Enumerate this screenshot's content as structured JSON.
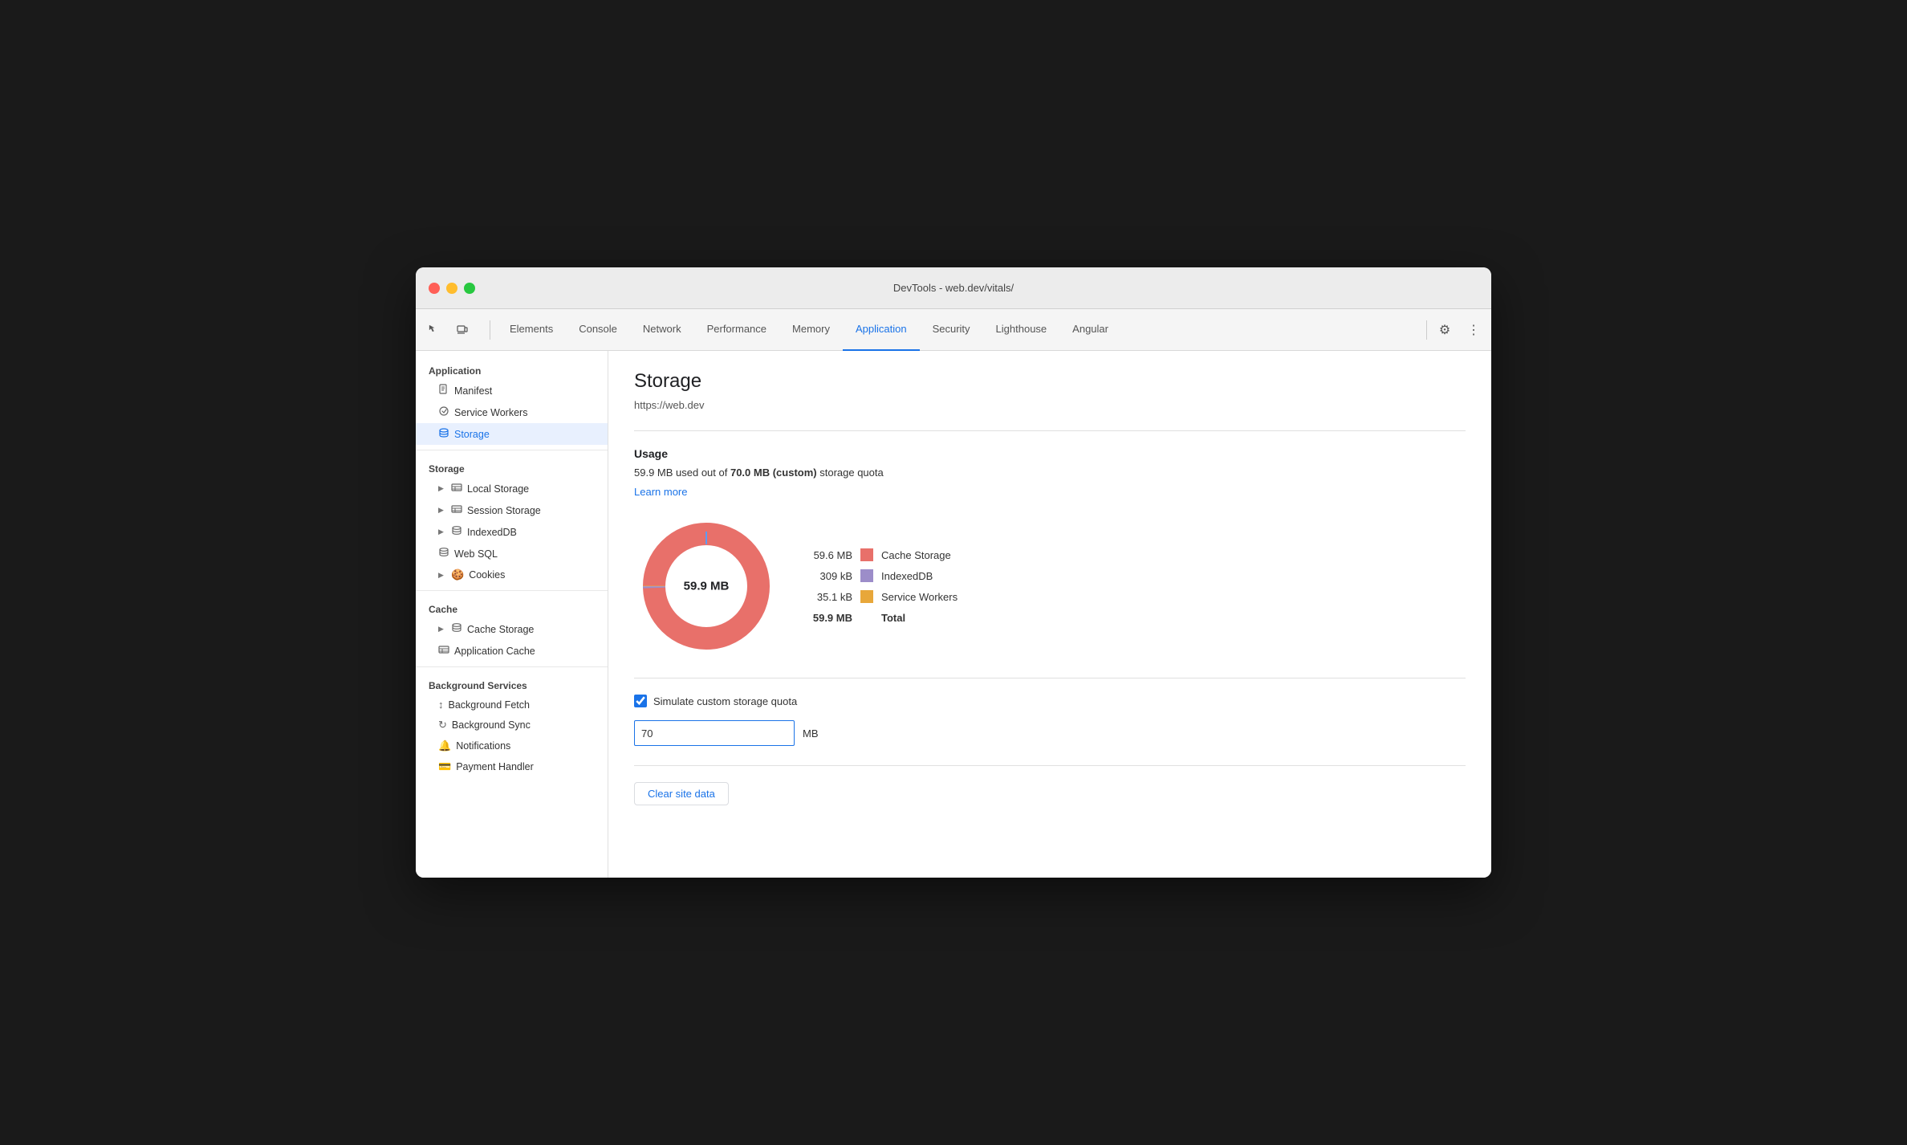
{
  "window": {
    "title": "DevTools - web.dev/vitals/"
  },
  "tabs": {
    "items": [
      {
        "label": "Elements",
        "active": false
      },
      {
        "label": "Console",
        "active": false
      },
      {
        "label": "Network",
        "active": false
      },
      {
        "label": "Performance",
        "active": false
      },
      {
        "label": "Memory",
        "active": false
      },
      {
        "label": "Application",
        "active": true
      },
      {
        "label": "Security",
        "active": false
      },
      {
        "label": "Lighthouse",
        "active": false
      },
      {
        "label": "Angular",
        "active": false
      }
    ]
  },
  "sidebar": {
    "application_label": "Application",
    "items_application": [
      {
        "label": "Manifest",
        "icon": "📄",
        "indent": 1
      },
      {
        "label": "Service Workers",
        "icon": "⚙️",
        "indent": 1
      },
      {
        "label": "Storage",
        "icon": "🗄️",
        "indent": 1,
        "active": true
      }
    ],
    "storage_label": "Storage",
    "items_storage": [
      {
        "label": "Local Storage",
        "icon": "▦",
        "indent": 1,
        "expandable": true
      },
      {
        "label": "Session Storage",
        "icon": "▦",
        "indent": 1,
        "expandable": true
      },
      {
        "label": "IndexedDB",
        "icon": "🗃️",
        "indent": 1,
        "expandable": true
      },
      {
        "label": "Web SQL",
        "icon": "🗃️",
        "indent": 1,
        "expandable": false
      },
      {
        "label": "Cookies",
        "icon": "🍪",
        "indent": 1,
        "expandable": true
      }
    ],
    "cache_label": "Cache",
    "items_cache": [
      {
        "label": "Cache Storage",
        "icon": "🗃️",
        "indent": 1,
        "expandable": true
      },
      {
        "label": "Application Cache",
        "icon": "▦",
        "indent": 1,
        "expandable": false
      }
    ],
    "background_services_label": "Background Services",
    "items_background": [
      {
        "label": "Background Fetch",
        "icon": "↕",
        "indent": 1
      },
      {
        "label": "Background Sync",
        "icon": "↻",
        "indent": 1
      },
      {
        "label": "Notifications",
        "icon": "🔔",
        "indent": 1
      },
      {
        "label": "Payment Handler",
        "icon": "💳",
        "indent": 1
      }
    ]
  },
  "content": {
    "title": "Storage",
    "url": "https://web.dev",
    "usage_title": "Usage",
    "usage_text_prefix": "59.9 MB used out of ",
    "usage_bold": "70.0 MB (custom)",
    "usage_text_suffix": " storage quota",
    "learn_more": "Learn more",
    "donut_center": "59.9 MB",
    "legend": [
      {
        "value": "59.6 MB",
        "label": "Cache Storage",
        "color": "#e8706a"
      },
      {
        "value": "309 kB",
        "label": "IndexedDB",
        "color": "#9c8dc9"
      },
      {
        "value": "35.1 kB",
        "label": "Service Workers",
        "color": "#e8a73a"
      },
      {
        "value": "59.9 MB",
        "label": "Total",
        "color": null,
        "bold": true
      }
    ],
    "checkbox_label": "Simulate custom storage quota",
    "checkbox_checked": true,
    "quota_value": "70",
    "quota_unit": "MB",
    "clear_btn_label": "Clear site data"
  }
}
